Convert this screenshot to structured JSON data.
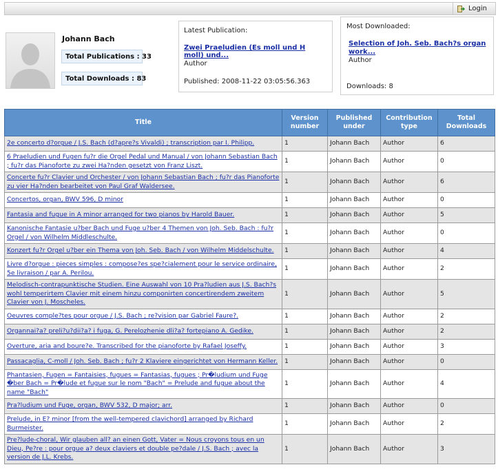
{
  "toolbar": {
    "login_label": "Login"
  },
  "profile": {
    "name": "Johann Bach",
    "total_publications": "Total Publications : 33",
    "total_downloads": "Total Downloads : 83"
  },
  "latest_publication": {
    "heading": "Latest Publication:",
    "title": "Zwei Praeludien (Es moll und H moll) und...",
    "role": "Author",
    "published": "Published: 2008-11-22 03:05:56.363"
  },
  "most_downloaded": {
    "heading": "Most Downloaded:",
    "title": "Selection of Joh. Seb. Bach?s organ work...",
    "role": "Author",
    "downloads": "Downloads: 8"
  },
  "table": {
    "headers": {
      "title": "Title",
      "version": "Version number",
      "published_under": "Published under",
      "contribution_type": "Contribution type",
      "total_downloads": "Total Downloads"
    },
    "rows": [
      {
        "title": "2e concerto d?orgue / J.S. Bach (d?apre?s Vivaldi) ; transcription par I. Philipp.",
        "version": "1",
        "published_under": "Johann Bach",
        "type": "Author",
        "downloads": "6"
      },
      {
        "title": "6 Praeludien und Fugen fu?r die Orgel Pedal und Manual / von Johann Sebastian Bach ; fu?r das Pianoforte zu zwei Ha?nden gesetzt von Franz Liszt.",
        "version": "1",
        "published_under": "Johann Bach",
        "type": "Author",
        "downloads": "0"
      },
      {
        "title": "Concerte fu?r Clavier und Orchester / von Johann Sebastian Bach ; fu?r das Pianoforte zu vier Ha?nden bearbeitet von Paul Graf Waldersee.",
        "version": "1",
        "published_under": "Johann Bach",
        "type": "Author",
        "downloads": "6"
      },
      {
        "title": "Concertos, organ, BWV 596, D minor",
        "version": "1",
        "published_under": "Johann Bach",
        "type": "Author",
        "downloads": "0"
      },
      {
        "title": "Fantasia and fugue in A minor arranged for two pianos by Harold Bauer.",
        "version": "1",
        "published_under": "Johann Bach",
        "type": "Author",
        "downloads": "5"
      },
      {
        "title": "Kanonische Fantasie u?ber Bach und Fuge u?ber 4 Themen von Joh. Seb. Bach : fu?r Orgel / von Wilhelm Middleschulte.",
        "version": "1",
        "published_under": "Johann Bach",
        "type": "Author",
        "downloads": "0"
      },
      {
        "title": "Konzert fu?r Orgel u?ber ein Thema von Joh. Seb. Bach / von Wilhelm Middelschulte.",
        "version": "1",
        "published_under": "Johann Bach",
        "type": "Author",
        "downloads": "4"
      },
      {
        "title": "Livre d?orgue : pieces simples : compose?es spe?cialement pour le service ordinaire, 5e livraison / par A. Perilou.",
        "version": "1",
        "published_under": "Johann Bach",
        "type": "Author",
        "downloads": "2"
      },
      {
        "title": "Melodisch-contrapunktische Studien. Eine Auswahl von 10 Pra?ludien aus J.S. Bach?s wohl temperirtem Clavier mit einem hinzu componirten concertirendem zweitem Clavier von J. Moscheles.",
        "version": "1",
        "published_under": "Johann Bach",
        "type": "Author",
        "downloads": "5"
      },
      {
        "title": "Oeuvres comple?tes pour orgue / J.S. Bach ; re?vision par Gabriel Faure?.",
        "version": "1",
        "published_under": "Johann Bach",
        "type": "Author",
        "downloads": "2"
      },
      {
        "title": "Organnai?a? preli?u?dii?a? i fuga, G. Perelozhenie dli?a? fortepiano A. Gedike.",
        "version": "1",
        "published_under": "Johann Bach",
        "type": "Author",
        "downloads": "2"
      },
      {
        "title": "Overture, aria and boure?e. Transcribed for the pianoforte by Rafael Joseffy.",
        "version": "1",
        "published_under": "Johann Bach",
        "type": "Author",
        "downloads": "3"
      },
      {
        "title": "Passacaglia, C-moll / Joh. Seb. Bach ; fu?r 2 Klaviere eingerichtet von Hermann Keller.",
        "version": "1",
        "published_under": "Johann Bach",
        "type": "Author",
        "downloads": "0"
      },
      {
        "title": "Phantasien, Fugen = Fantaisies, fugues = Fantasias, fugues ; Pr�ludium und Fuge �ber Bach = Pr�lude et fugue sur le nom \"Bach\" = Prelude and fugue about the name \"Bach\"",
        "version": "1",
        "published_under": "Johann Bach",
        "type": "Author",
        "downloads": "4"
      },
      {
        "title": "Pra?ludium und Fuge, organ, BWV 532, D major; arr.",
        "version": "1",
        "published_under": "Johann Bach",
        "type": "Author",
        "downloads": "0"
      },
      {
        "title": "Prelude, in E? minor [from the well-tempered clavichord] arranged by Richard Burmeister.",
        "version": "1",
        "published_under": "Johann Bach",
        "type": "Author",
        "downloads": "2"
      },
      {
        "title": "Pre?lude-choral, Wir glauben all? an einen Gott, Vater = Nous croyons tous en un Dieu, Pe?re : pour orgue a? deux claviers et double pe?dale / J.S. Bach ; avec la version de J.L. Krebs.",
        "version": "1",
        "published_under": "Johann Bach",
        "type": "Author",
        "downloads": "3"
      }
    ]
  }
}
